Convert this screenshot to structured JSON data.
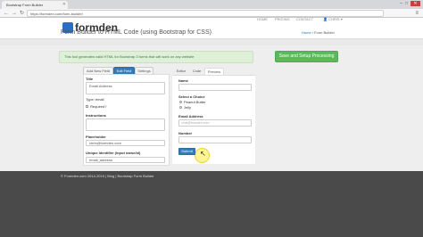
{
  "browser": {
    "tab_title": "Bootstrap Form Builder",
    "url": "https://formden.com/form-builder/"
  },
  "header": {
    "logo": "formden",
    "nav": {
      "home": "HOME",
      "pricing": "PRICING",
      "contact": "CONTACT",
      "user": "CHRIS"
    }
  },
  "page": {
    "title": "Form Builder to HTML Code (using Bootstrap for CSS)",
    "breadcrumb_home": "Home",
    "breadcrumb_sep": "/",
    "breadcrumb_current": "Form Builder"
  },
  "alert": {
    "text": "This tool generates valid HTML for Bootstrap 3 forms that will work on any website"
  },
  "save_button": "Save and Setup Processing",
  "editor": {
    "tabs": [
      "Add New Field",
      "Edit Field",
      "Settings"
    ],
    "fields": {
      "title_label": "Title",
      "title_value": "Email Address",
      "type_label": "Type: email",
      "required_label": "Required?",
      "instructions_label": "Instructions",
      "placeholder_label": "Placeholder",
      "placeholder_value": "chris@formden.com",
      "identifier_label": "Unique Identifier (input name/id)",
      "identifier_value": "email_address"
    }
  },
  "preview": {
    "tabs": [
      "Editor",
      "Code",
      "Preview"
    ],
    "name_label": "Name",
    "choice_label": "Select a Choice",
    "choices": [
      "Peanut Butter",
      "Jelly"
    ],
    "email_label": "Email Address",
    "email_placeholder": "chris@formden.com",
    "number_label": "Number",
    "submit_label": "Submit"
  },
  "footer": {
    "text": "© Formden.com 2014-2015  |  Blog  |  Bootstrap Form Builder"
  }
}
